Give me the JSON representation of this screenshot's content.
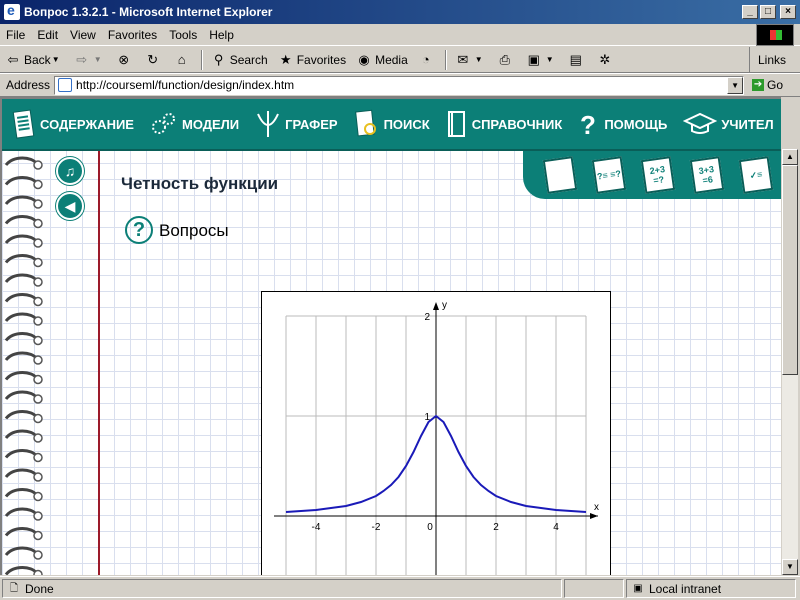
{
  "window": {
    "title": "Вопрос 1.3.2.1 - Microsoft Internet Explorer"
  },
  "menu": [
    "File",
    "Edit",
    "View",
    "Favorites",
    "Tools",
    "Help"
  ],
  "toolbar": {
    "back": "Back",
    "search": "Search",
    "favorites": "Favorites",
    "media": "Media",
    "links": "Links"
  },
  "address": {
    "label": "Address",
    "url": "http://courseml/function/design/index.htm",
    "go": "Go"
  },
  "nav": [
    "СОДЕРЖАНИЕ",
    "МОДЕЛИ",
    "ГРАФЕР",
    "ПОИСК",
    "СПРАВОЧНИК",
    "ПОМОЩЬ",
    "УЧИТЕЛ"
  ],
  "tab_icons": [
    "book-icon",
    "question-list-icon",
    "exercise-icon",
    "calc-icon",
    "checklist-icon"
  ],
  "tab_labels": [
    "",
    "?≡ ≡?",
    "2+3 =?",
    "3+3 =6",
    "✓≡"
  ],
  "page": {
    "title": "Четность функции",
    "section": "Вопросы"
  },
  "status": {
    "left": "Done",
    "zone": "Local intranet"
  },
  "colors": {
    "accent": "#0c7f77",
    "margin_line": "#9c1a2a",
    "curve": "#1a1ab8"
  },
  "chart_data": {
    "type": "line",
    "xlabel": "x",
    "ylabel": "y",
    "xlim": [
      -5,
      5
    ],
    "ylim": [
      0,
      2
    ],
    "x_ticks": [
      -4,
      -2,
      0,
      2,
      4
    ],
    "y_ticks": [
      1,
      2
    ],
    "grid": true,
    "x": [
      -5,
      -4.5,
      -4,
      -3.5,
      -3,
      -2.5,
      -2,
      -1.75,
      -1.5,
      -1.25,
      -1,
      -0.75,
      -0.5,
      -0.25,
      0,
      0.25,
      0.5,
      0.75,
      1,
      1.25,
      1.5,
      1.75,
      2,
      2.5,
      3,
      3.5,
      4,
      4.5,
      5
    ],
    "y": [
      0.04,
      0.05,
      0.06,
      0.08,
      0.1,
      0.14,
      0.2,
      0.25,
      0.31,
      0.39,
      0.5,
      0.64,
      0.8,
      0.94,
      1,
      0.94,
      0.8,
      0.64,
      0.5,
      0.39,
      0.31,
      0.25,
      0.2,
      0.14,
      0.1,
      0.08,
      0.06,
      0.05,
      0.04
    ]
  }
}
